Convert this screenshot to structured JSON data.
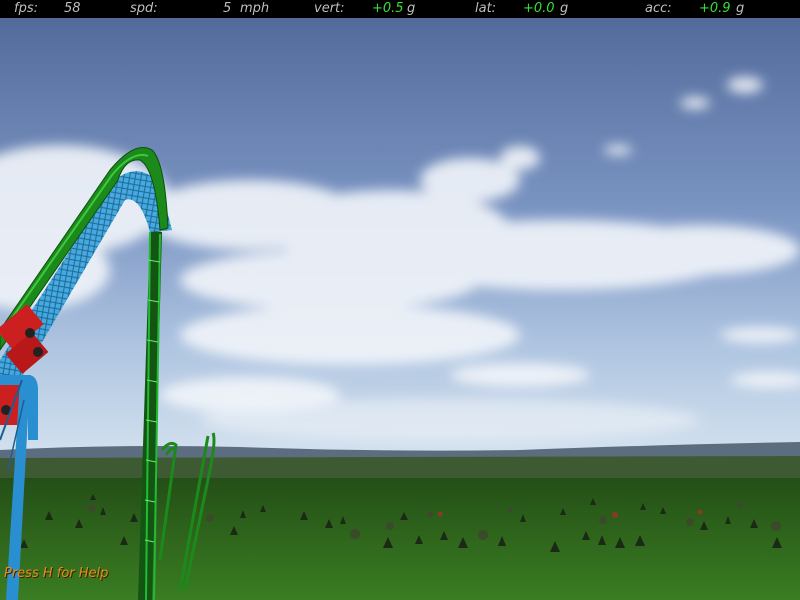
{
  "hud": {
    "fps_label": "fps:",
    "fps_value": "58",
    "spd_label": "spd:",
    "spd_value": "5",
    "spd_unit": "mph",
    "vert_label": "vert:",
    "vert_value": "+0.5",
    "vert_unit": "g",
    "lat_label": "lat:",
    "lat_value": "+0.0",
    "lat_unit": "g",
    "acc_label": "acc:",
    "acc_value": "+0.9",
    "acc_unit": "g"
  },
  "help_text": "Press H for Help",
  "colors": {
    "hud_bg": "#000000",
    "hud_text": "#bfbfbf",
    "hud_value_green": "#33e233",
    "help_text": "#e0901c",
    "track_green": "#1b8a1b",
    "support_blue": "#2a8fd0",
    "train_red": "#cc2020",
    "grass": "#2f6a1e"
  }
}
